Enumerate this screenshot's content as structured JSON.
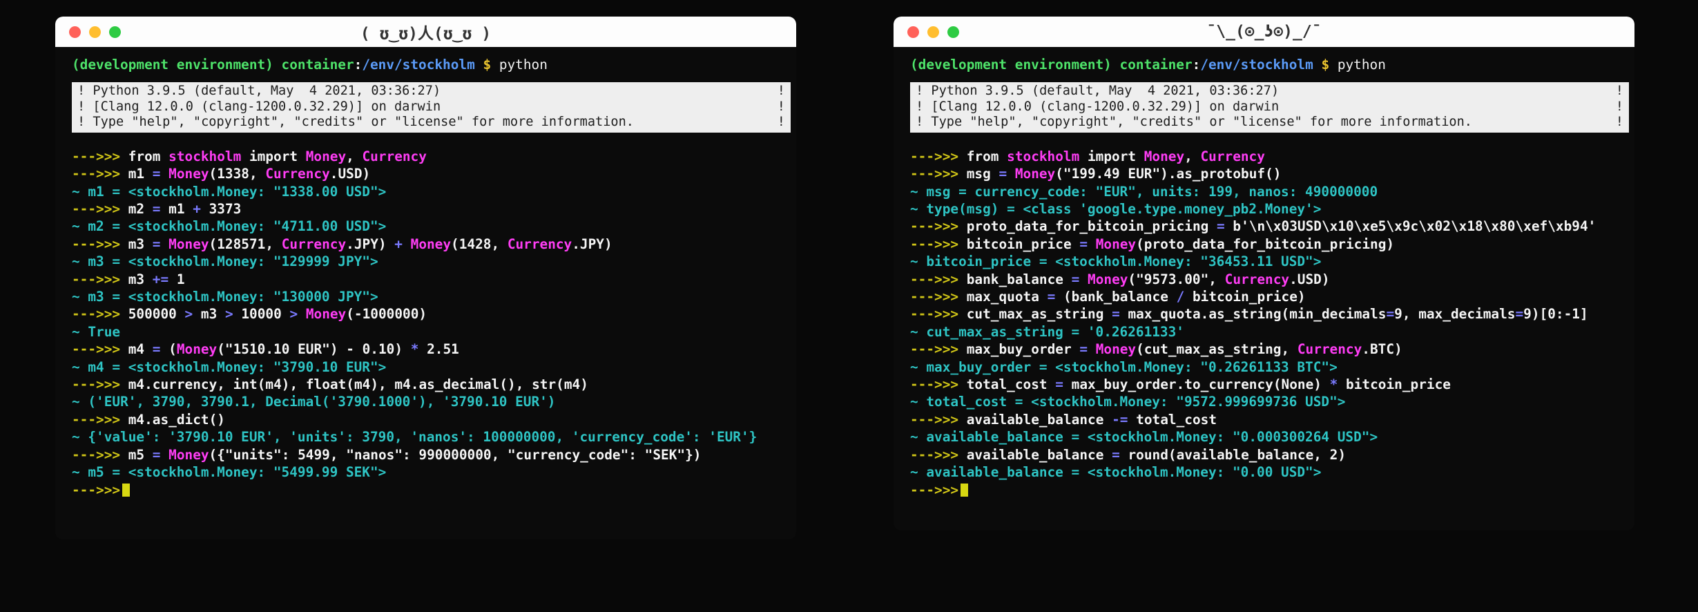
{
  "desktop": {
    "background": "#080808"
  },
  "colors": {
    "prompt_arrow": "#cfc417",
    "output_tilde": "#2ec4c4",
    "keyword": "#ff3df5",
    "operator": "#7a7aff",
    "plain": "#f5f5f5",
    "venv": "#4ee36a",
    "path": "#5b9bf8",
    "dollar": "#e8c22e",
    "banner_bg": "#eeeeee",
    "titlebar_bg": "#fdfdfd",
    "light_red": "#ff6159",
    "light_yellow": "#ffbe2f",
    "light_green": "#2ecb43"
  },
  "windows": [
    {
      "id": "left",
      "title": "( ʊ‿ʊ)人(ʊ‿ʊ )",
      "traffic_lights": [
        "close-button",
        "minimize-button",
        "maximize-button"
      ],
      "prompt": {
        "venv": "(development environment)",
        "host": "container",
        "colon": ":",
        "path": "/env/stockholm",
        "dollar": "$",
        "command": "python"
      },
      "banner": [
        "! Python 3.9.5 (default, May  4 2021, 03:36:27)",
        "! [Clang 12.0.0 (clang-1200.0.32.29)] on darwin",
        "! Type \"help\", \"copyright\", \"credits\" or \"license\" for more information."
      ],
      "banner_right_marks": [
        "!",
        "!",
        "!"
      ],
      "lines": [
        {
          "kind": "input",
          "text": "from stockholm import Money, Currency"
        },
        {
          "kind": "input",
          "text": "m1 = Money(1338, Currency.USD)"
        },
        {
          "kind": "output",
          "text": "m1 = <stockholm.Money: \"1338.00 USD\">"
        },
        {
          "kind": "input",
          "text": "m2 = m1 + 3373"
        },
        {
          "kind": "output",
          "text": "m2 = <stockholm.Money: \"4711.00 USD\">"
        },
        {
          "kind": "input",
          "text": "m3 = Money(128571, Currency.JPY) + Money(1428, Currency.JPY)"
        },
        {
          "kind": "output",
          "text": "m3 = <stockholm.Money: \"129999 JPY\">"
        },
        {
          "kind": "input",
          "text": "m3 += 1"
        },
        {
          "kind": "output",
          "text": "m3 = <stockholm.Money: \"130000 JPY\">"
        },
        {
          "kind": "input",
          "text": "500000 > m3 > 10000 > Money(-1000000)"
        },
        {
          "kind": "output",
          "text": "True"
        },
        {
          "kind": "input",
          "text": "m4 = (Money(\"1510.10 EUR\") - 0.10) * 2.51"
        },
        {
          "kind": "output",
          "text": "m4 = <stockholm.Money: \"3790.10 EUR\">"
        },
        {
          "kind": "input",
          "text": "m4.currency, int(m4), float(m4), m4.as_decimal(), str(m4)"
        },
        {
          "kind": "output",
          "text": "('EUR', 3790, 3790.1, Decimal('3790.1000'), '3790.10 EUR')"
        },
        {
          "kind": "input",
          "text": "m4.as_dict()"
        },
        {
          "kind": "output",
          "text": "{'value': '3790.10 EUR', 'units': 3790, 'nanos': 100000000, 'currency_code': 'EUR'}"
        },
        {
          "kind": "input",
          "text": "m5 = Money({\"units\": 5499, \"nanos\": 990000000, \"currency_code\": \"SEK\"})"
        },
        {
          "kind": "output",
          "text": "m5 = <stockholm.Money: \"5499.99 SEK\">"
        },
        {
          "kind": "cursor",
          "text": ""
        }
      ]
    },
    {
      "id": "right",
      "title": "¯\\_(⊙_ʖ⊙)_/¯",
      "traffic_lights": [
        "close-button",
        "minimize-button",
        "maximize-button"
      ],
      "prompt": {
        "venv": "(development environment)",
        "host": "container",
        "colon": ":",
        "path": "/env/stockholm",
        "dollar": "$",
        "command": "python"
      },
      "banner": [
        "! Python 3.9.5 (default, May  4 2021, 03:36:27)",
        "! [Clang 12.0.0 (clang-1200.0.32.29)] on darwin",
        "! Type \"help\", \"copyright\", \"credits\" or \"license\" for more information."
      ],
      "banner_right_marks": [
        "!",
        "!",
        "!"
      ],
      "lines": [
        {
          "kind": "input",
          "text": "from stockholm import Money, Currency"
        },
        {
          "kind": "input",
          "text": "msg = Money(\"199.49 EUR\").as_protobuf()"
        },
        {
          "kind": "output",
          "text": "msg = currency_code: \"EUR\", units: 199, nanos: 490000000"
        },
        {
          "kind": "output",
          "text": "type(msg) = <class 'google.type.money_pb2.Money'>"
        },
        {
          "kind": "input",
          "text": "proto_data_for_bitcoin_pricing = b'\\n\\x03USD\\x10\\xe5\\x9c\\x02\\x18\\x80\\xef\\xb94'"
        },
        {
          "kind": "input",
          "text": "bitcoin_price = Money(proto_data_for_bitcoin_pricing)"
        },
        {
          "kind": "output",
          "text": "bitcoin_price = <stockholm.Money: \"36453.11 USD\">"
        },
        {
          "kind": "input",
          "text": "bank_balance = Money(\"9573.00\", Currency.USD)"
        },
        {
          "kind": "input",
          "text": "max_quota = (bank_balance / bitcoin_price)"
        },
        {
          "kind": "input",
          "text": "cut_max_as_string = max_quota.as_string(min_decimals=9, max_decimals=9)[0:-1]"
        },
        {
          "kind": "output",
          "text": "cut_max_as_string = '0.26261133'"
        },
        {
          "kind": "input",
          "text": "max_buy_order = Money(cut_max_as_string, Currency.BTC)"
        },
        {
          "kind": "output",
          "text": "max_buy_order = <stockholm.Money: \"0.26261133 BTC\">"
        },
        {
          "kind": "input",
          "text": "total_cost = max_buy_order.to_currency(None) * bitcoin_price"
        },
        {
          "kind": "output",
          "text": "total_cost = <stockholm.Money: \"9572.999699736 USD\">"
        },
        {
          "kind": "input",
          "text": "available_balance -= total_cost"
        },
        {
          "kind": "output",
          "text": "available_balance = <stockholm.Money: \"0.000300264 USD\">"
        },
        {
          "kind": "input",
          "text": "available_balance = round(available_balance, 2)"
        },
        {
          "kind": "output",
          "text": "available_balance = <stockholm.Money: \"0.00 USD\">"
        },
        {
          "kind": "cursor",
          "text": ""
        }
      ]
    }
  ],
  "prompt_symbol": "--->>>",
  "output_symbol": "~"
}
